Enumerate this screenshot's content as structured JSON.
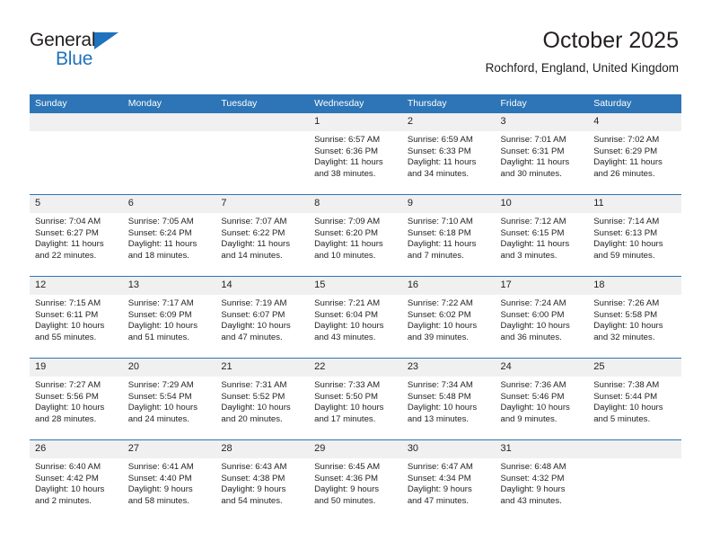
{
  "brand": {
    "name_top": "General",
    "name_bottom": "Blue",
    "accent_color": "#1f72bd"
  },
  "header": {
    "title": "October 2025",
    "subtitle": "Rochford, England, United Kingdom"
  },
  "calendar": {
    "header_bg": "#2d75b6",
    "daynum_bg": "#f0f0f0",
    "weekday_headers": [
      "Sunday",
      "Monday",
      "Tuesday",
      "Wednesday",
      "Thursday",
      "Friday",
      "Saturday"
    ],
    "weeks": [
      [
        {
          "day": "",
          "empty": true
        },
        {
          "day": "",
          "empty": true
        },
        {
          "day": "",
          "empty": true
        },
        {
          "day": "1",
          "sunrise": "Sunrise: 6:57 AM",
          "sunset": "Sunset: 6:36 PM",
          "daylight_1": "Daylight: 11 hours",
          "daylight_2": "and 38 minutes."
        },
        {
          "day": "2",
          "sunrise": "Sunrise: 6:59 AM",
          "sunset": "Sunset: 6:33 PM",
          "daylight_1": "Daylight: 11 hours",
          "daylight_2": "and 34 minutes."
        },
        {
          "day": "3",
          "sunrise": "Sunrise: 7:01 AM",
          "sunset": "Sunset: 6:31 PM",
          "daylight_1": "Daylight: 11 hours",
          "daylight_2": "and 30 minutes."
        },
        {
          "day": "4",
          "sunrise": "Sunrise: 7:02 AM",
          "sunset": "Sunset: 6:29 PM",
          "daylight_1": "Daylight: 11 hours",
          "daylight_2": "and 26 minutes."
        }
      ],
      [
        {
          "day": "5",
          "sunrise": "Sunrise: 7:04 AM",
          "sunset": "Sunset: 6:27 PM",
          "daylight_1": "Daylight: 11 hours",
          "daylight_2": "and 22 minutes."
        },
        {
          "day": "6",
          "sunrise": "Sunrise: 7:05 AM",
          "sunset": "Sunset: 6:24 PM",
          "daylight_1": "Daylight: 11 hours",
          "daylight_2": "and 18 minutes."
        },
        {
          "day": "7",
          "sunrise": "Sunrise: 7:07 AM",
          "sunset": "Sunset: 6:22 PM",
          "daylight_1": "Daylight: 11 hours",
          "daylight_2": "and 14 minutes."
        },
        {
          "day": "8",
          "sunrise": "Sunrise: 7:09 AM",
          "sunset": "Sunset: 6:20 PM",
          "daylight_1": "Daylight: 11 hours",
          "daylight_2": "and 10 minutes."
        },
        {
          "day": "9",
          "sunrise": "Sunrise: 7:10 AM",
          "sunset": "Sunset: 6:18 PM",
          "daylight_1": "Daylight: 11 hours",
          "daylight_2": "and 7 minutes."
        },
        {
          "day": "10",
          "sunrise": "Sunrise: 7:12 AM",
          "sunset": "Sunset: 6:15 PM",
          "daylight_1": "Daylight: 11 hours",
          "daylight_2": "and 3 minutes."
        },
        {
          "day": "11",
          "sunrise": "Sunrise: 7:14 AM",
          "sunset": "Sunset: 6:13 PM",
          "daylight_1": "Daylight: 10 hours",
          "daylight_2": "and 59 minutes."
        }
      ],
      [
        {
          "day": "12",
          "sunrise": "Sunrise: 7:15 AM",
          "sunset": "Sunset: 6:11 PM",
          "daylight_1": "Daylight: 10 hours",
          "daylight_2": "and 55 minutes."
        },
        {
          "day": "13",
          "sunrise": "Sunrise: 7:17 AM",
          "sunset": "Sunset: 6:09 PM",
          "daylight_1": "Daylight: 10 hours",
          "daylight_2": "and 51 minutes."
        },
        {
          "day": "14",
          "sunrise": "Sunrise: 7:19 AM",
          "sunset": "Sunset: 6:07 PM",
          "daylight_1": "Daylight: 10 hours",
          "daylight_2": "and 47 minutes."
        },
        {
          "day": "15",
          "sunrise": "Sunrise: 7:21 AM",
          "sunset": "Sunset: 6:04 PM",
          "daylight_1": "Daylight: 10 hours",
          "daylight_2": "and 43 minutes."
        },
        {
          "day": "16",
          "sunrise": "Sunrise: 7:22 AM",
          "sunset": "Sunset: 6:02 PM",
          "daylight_1": "Daylight: 10 hours",
          "daylight_2": "and 39 minutes."
        },
        {
          "day": "17",
          "sunrise": "Sunrise: 7:24 AM",
          "sunset": "Sunset: 6:00 PM",
          "daylight_1": "Daylight: 10 hours",
          "daylight_2": "and 36 minutes."
        },
        {
          "day": "18",
          "sunrise": "Sunrise: 7:26 AM",
          "sunset": "Sunset: 5:58 PM",
          "daylight_1": "Daylight: 10 hours",
          "daylight_2": "and 32 minutes."
        }
      ],
      [
        {
          "day": "19",
          "sunrise": "Sunrise: 7:27 AM",
          "sunset": "Sunset: 5:56 PM",
          "daylight_1": "Daylight: 10 hours",
          "daylight_2": "and 28 minutes."
        },
        {
          "day": "20",
          "sunrise": "Sunrise: 7:29 AM",
          "sunset": "Sunset: 5:54 PM",
          "daylight_1": "Daylight: 10 hours",
          "daylight_2": "and 24 minutes."
        },
        {
          "day": "21",
          "sunrise": "Sunrise: 7:31 AM",
          "sunset": "Sunset: 5:52 PM",
          "daylight_1": "Daylight: 10 hours",
          "daylight_2": "and 20 minutes."
        },
        {
          "day": "22",
          "sunrise": "Sunrise: 7:33 AM",
          "sunset": "Sunset: 5:50 PM",
          "daylight_1": "Daylight: 10 hours",
          "daylight_2": "and 17 minutes."
        },
        {
          "day": "23",
          "sunrise": "Sunrise: 7:34 AM",
          "sunset": "Sunset: 5:48 PM",
          "daylight_1": "Daylight: 10 hours",
          "daylight_2": "and 13 minutes."
        },
        {
          "day": "24",
          "sunrise": "Sunrise: 7:36 AM",
          "sunset": "Sunset: 5:46 PM",
          "daylight_1": "Daylight: 10 hours",
          "daylight_2": "and 9 minutes."
        },
        {
          "day": "25",
          "sunrise": "Sunrise: 7:38 AM",
          "sunset": "Sunset: 5:44 PM",
          "daylight_1": "Daylight: 10 hours",
          "daylight_2": "and 5 minutes."
        }
      ],
      [
        {
          "day": "26",
          "sunrise": "Sunrise: 6:40 AM",
          "sunset": "Sunset: 4:42 PM",
          "daylight_1": "Daylight: 10 hours",
          "daylight_2": "and 2 minutes."
        },
        {
          "day": "27",
          "sunrise": "Sunrise: 6:41 AM",
          "sunset": "Sunset: 4:40 PM",
          "daylight_1": "Daylight: 9 hours",
          "daylight_2": "and 58 minutes."
        },
        {
          "day": "28",
          "sunrise": "Sunrise: 6:43 AM",
          "sunset": "Sunset: 4:38 PM",
          "daylight_1": "Daylight: 9 hours",
          "daylight_2": "and 54 minutes."
        },
        {
          "day": "29",
          "sunrise": "Sunrise: 6:45 AM",
          "sunset": "Sunset: 4:36 PM",
          "daylight_1": "Daylight: 9 hours",
          "daylight_2": "and 50 minutes."
        },
        {
          "day": "30",
          "sunrise": "Sunrise: 6:47 AM",
          "sunset": "Sunset: 4:34 PM",
          "daylight_1": "Daylight: 9 hours",
          "daylight_2": "and 47 minutes."
        },
        {
          "day": "31",
          "sunrise": "Sunrise: 6:48 AM",
          "sunset": "Sunset: 4:32 PM",
          "daylight_1": "Daylight: 9 hours",
          "daylight_2": "and 43 minutes."
        },
        {
          "day": "",
          "empty": true
        }
      ]
    ]
  }
}
